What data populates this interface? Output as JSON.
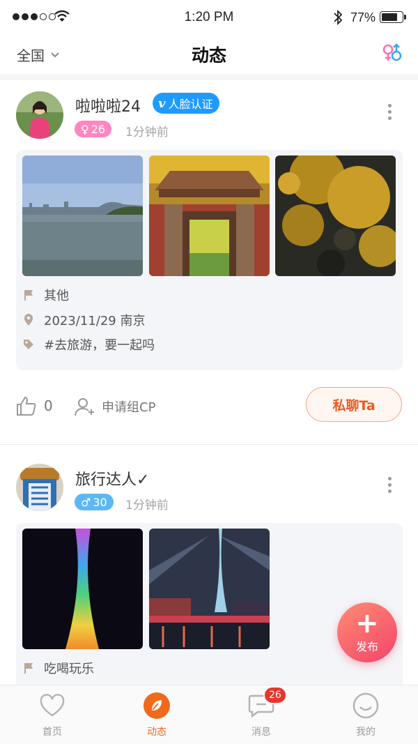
{
  "status_bar": {
    "time": "1:20 PM",
    "battery": "77%",
    "battery_level": 0.77
  },
  "nav": {
    "region": "全国",
    "title": "动态"
  },
  "posts": [
    {
      "username": "啦啦啦24",
      "verify_label": "人脸认证",
      "gender": "female",
      "age": "26",
      "time": "1分钟前",
      "category": "其他",
      "date_location": "2023/11/29  南京",
      "tag": "#去旅游，要一起吗",
      "likes": "0",
      "cp_label": "申请组CP",
      "chat_label": "私聊Ta"
    },
    {
      "username": "旅行达人✓",
      "gender": "male",
      "age": "30",
      "time": "1分钟前",
      "category": "吃喝玩乐"
    }
  ],
  "fab": {
    "label": "发布"
  },
  "tabs": [
    {
      "label": "首页",
      "icon": "heart-icon"
    },
    {
      "label": "动态",
      "icon": "leaf-icon",
      "active": true
    },
    {
      "label": "消息",
      "icon": "message-icon",
      "badge": "26"
    },
    {
      "label": "我的",
      "icon": "smile-icon"
    }
  ],
  "colors": {
    "accent": "#f16a1a",
    "badge": "#e8352b",
    "verify": "#1e9bff",
    "female": "#ff86c0",
    "male": "#5cb8f5"
  }
}
